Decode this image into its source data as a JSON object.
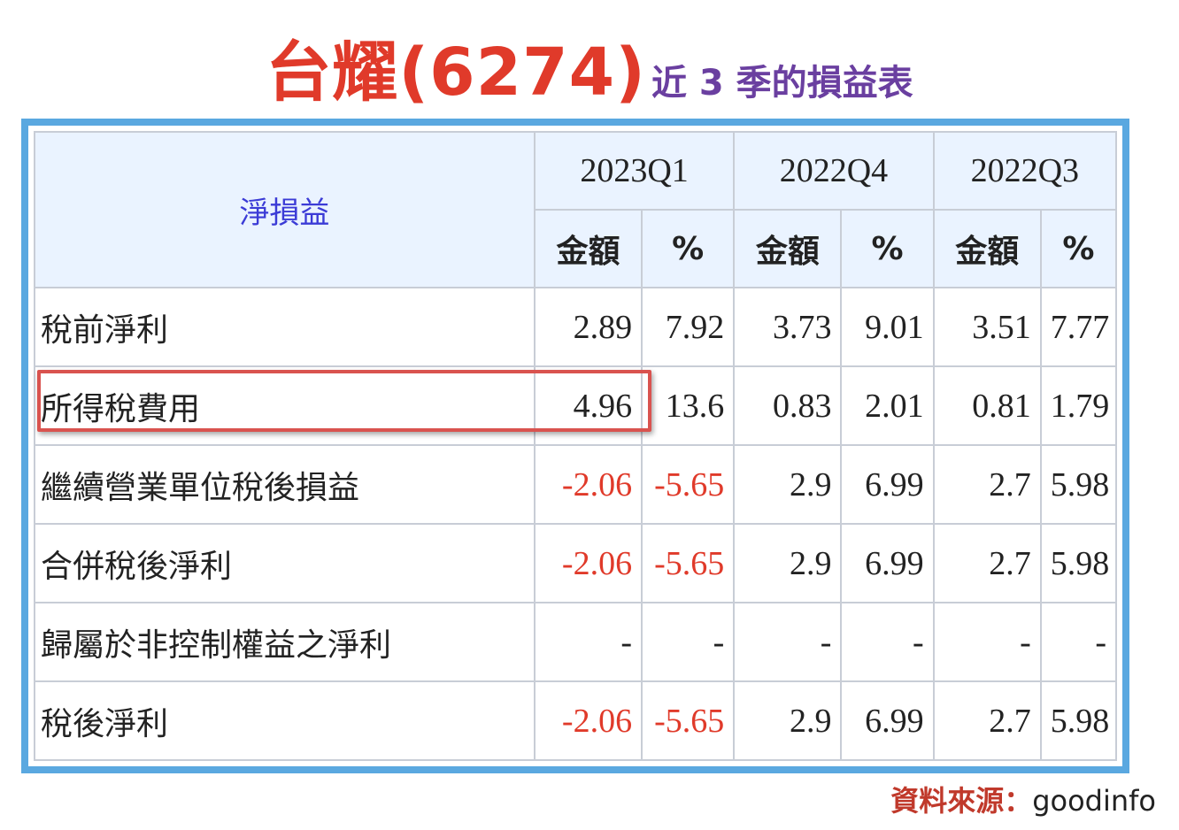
{
  "title": {
    "main": "台耀(6274)",
    "sub": "近 3 季的損益表"
  },
  "table": {
    "corner_label": "淨損益",
    "periods": [
      "2023Q1",
      "2022Q4",
      "2022Q3"
    ],
    "sub_headers": {
      "amount": "金額",
      "percent": "%"
    },
    "rows": [
      {
        "label": "稅前淨利",
        "cells": [
          "2.89",
          "7.92",
          "3.73",
          "9.01",
          "3.51",
          "7.77"
        ]
      },
      {
        "label": "所得稅費用",
        "cells": [
          "4.96",
          "13.6",
          "0.83",
          "2.01",
          "0.81",
          "1.79"
        ]
      },
      {
        "label": "繼續營業單位稅後損益",
        "cells": [
          "-2.06",
          "-5.65",
          "2.9",
          "6.99",
          "2.7",
          "5.98"
        ]
      },
      {
        "label": "合併稅後淨利",
        "cells": [
          "-2.06",
          "-5.65",
          "2.9",
          "6.99",
          "2.7",
          "5.98"
        ]
      },
      {
        "label": "歸屬於非控制權益之淨利",
        "cells": [
          "-",
          "-",
          "-",
          "-",
          "-",
          "-"
        ]
      },
      {
        "label": "稅後淨利",
        "cells": [
          "-2.06",
          "-5.65",
          "2.9",
          "6.99",
          "2.7",
          "5.98"
        ]
      }
    ]
  },
  "source": {
    "label": "資料來源：",
    "value": "goodinfo"
  },
  "colors": {
    "title": "#e03a2a",
    "subtitle": "#6a3fa0",
    "negative": "#e03a2a",
    "frame": "#5aa8e0",
    "highlight": "#d9534f"
  }
}
